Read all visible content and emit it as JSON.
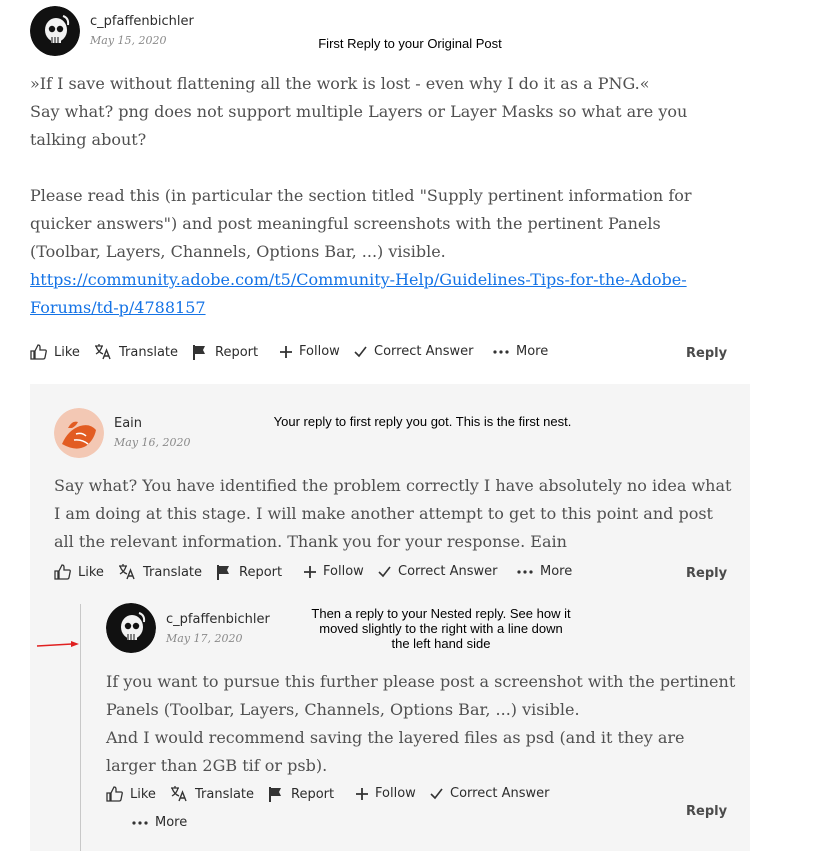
{
  "post1": {
    "username": "c_pfaffenbichler",
    "date": "May 15, 2020",
    "annotation": "First Reply to your Original Post",
    "body": [
      "»If I save without flattening all the work is lost - even why I do it as a PNG.«",
      "Say what? png does not support multiple Layers or Layer Masks so what are you talking about?",
      "",
      "Please read this (in particular the section titled \"Supply pertinent information for quicker answers\") and post meaningful screenshots with the pertinent Panels (Toolbar, Layers, Channels, Options Bar, ...) visible."
    ],
    "link": "https://community.adobe.com/t5/Community-Help/Guidelines-Tips-for-the-Adobe-Forums/td-p/4788157",
    "link_line1": "https://community.adobe.com/t5/Community-Help/Guidelines-Tips-for-the-Adobe-",
    "link_line2": "Forums/td-p/4788157"
  },
  "post2": {
    "username": "Eain",
    "date": "May 16, 2020",
    "annotation": "Your reply to first reply you got. This is the first nest.",
    "body": "Say what?  You  have identified the problem correctly I have absolutely no idea what I am doing at this stage. I will make another attempt  to get to this point and post all the relevant information. Thank you for your response. Eain"
  },
  "post3": {
    "username": "c_pfaffenbichler",
    "date": "May 17, 2020",
    "annotation_line1": "Then a reply to your Nested reply. See how it",
    "annotation_line2": "moved slightly to the right with a line down",
    "annotation_line3": "the left hand side",
    "body_line1": "If you want to pursue this further please post a screenshot with the pertinent Panels (Toolbar, Layers, Channels, Options Bar, ...) visible.",
    "body_line2": "And I would recommend saving the layered files as psd (and it they are larger than 2GB tif or psb)."
  },
  "actions": {
    "like": "Like",
    "translate": "Translate",
    "report": "Report",
    "follow": "Follow",
    "correct_answer": "Correct Answer",
    "more": "More",
    "reply": "Reply"
  },
  "colors": {
    "link": "#1473e6",
    "nest_background": "#f5f5f5",
    "annotation_arrow": "#e02020"
  }
}
